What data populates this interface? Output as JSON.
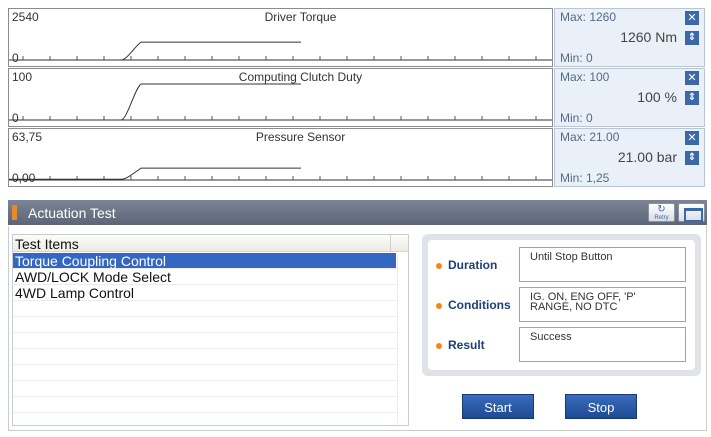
{
  "graphs": [
    {
      "max_label": "2540",
      "min_label": "0",
      "title": "Driver Torque",
      "side_max": "Max: 1260",
      "side_min": "Min: 0",
      "value": "1260 Nm",
      "trace": {
        "ymin": 0,
        "ymax": 2540,
        "start": 0,
        "end": 1260
      }
    },
    {
      "max_label": "100",
      "min_label": "0",
      "title": "Computing Clutch Duty",
      "side_max": "Max: 100",
      "side_min": "Min: 0",
      "value": "100 %",
      "trace": {
        "ymin": 0,
        "ymax": 100,
        "start": 0,
        "end": 100
      }
    },
    {
      "max_label": "63,75",
      "min_label": "0,00",
      "title": "Pressure Sensor",
      "side_max": "Max: 21.00",
      "side_min": "Min: 1,25",
      "value": "21.00 bar",
      "trace": {
        "ymin": 0,
        "ymax": 63.75,
        "start": 1.25,
        "end": 21.0
      }
    }
  ],
  "actuation": {
    "title": "Actuation Test",
    "retry_label": "Retry",
    "list_header": "Test Items",
    "items": [
      "Torque Coupling Control",
      "AWD/LOCK Mode Select",
      "4WD Lamp Control"
    ],
    "selected_index": 0,
    "info": {
      "duration_label": "Duration",
      "duration_value": "Until Stop Button",
      "conditions_label": "Conditions",
      "conditions_value": "IG. ON, ENG OFF, 'P' RANGE, NO DTC",
      "result_label": "Result",
      "result_value": "Success"
    },
    "start_label": "Start",
    "stop_label": "Stop"
  },
  "colors": {
    "header_bg": "#5f6878",
    "selected_row": "#3467c2",
    "button_bg": "#2a5aa8",
    "accent_orange": "#e88a2a",
    "side_panel_bg": "#e9f0f8"
  }
}
